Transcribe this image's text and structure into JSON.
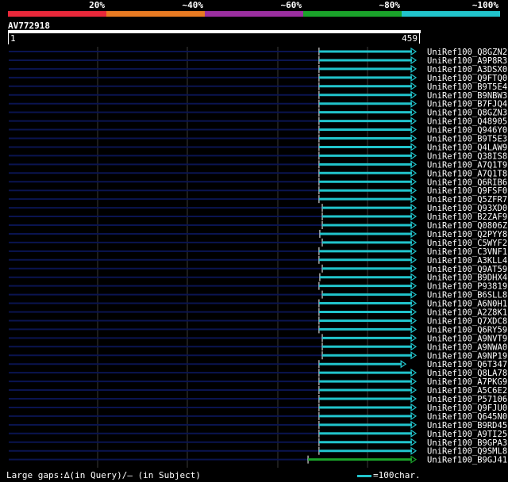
{
  "legend": {
    "segments": [
      {
        "label": "20%",
        "color": "#e8283a"
      },
      {
        "label": "~40%",
        "color": "#e87a22"
      },
      {
        "label": "~60%",
        "color": "#9b2fa0"
      },
      {
        "label": "~80%",
        "color": "#1aa32a"
      },
      {
        "label": "~100%",
        "color": "#21c4cc"
      }
    ]
  },
  "query": {
    "id": "AV772918",
    "start": "1",
    "end": "459"
  },
  "colors": {
    "unaligned": "#0a1450",
    "hit": "#21c4cc",
    "hit_alt": "#1aa32a",
    "grid": "#3a3a3a"
  },
  "hits": [
    {
      "label": "UniRef100_Q8GZN2",
      "start": 0.762,
      "end": 1.0,
      "color": "hit"
    },
    {
      "label": "UniRef100_A9P8R3",
      "start": 0.762,
      "end": 1.0,
      "color": "hit"
    },
    {
      "label": "UniRef100_A3DSX0",
      "start": 0.762,
      "end": 1.0,
      "color": "hit"
    },
    {
      "label": "UniRef100_Q9FTQ0",
      "start": 0.762,
      "end": 1.0,
      "color": "hit"
    },
    {
      "label": "UniRef100_B9T5E4",
      "start": 0.762,
      "end": 1.0,
      "color": "hit"
    },
    {
      "label": "UniRef100_B9NBW3",
      "start": 0.762,
      "end": 1.0,
      "color": "hit"
    },
    {
      "label": "UniRef100_B7FJQ4",
      "start": 0.762,
      "end": 1.0,
      "color": "hit"
    },
    {
      "label": "UniRef100_Q8GZN3",
      "start": 0.762,
      "end": 1.0,
      "color": "hit"
    },
    {
      "label": "UniRef100_Q48905",
      "start": 0.762,
      "end": 1.0,
      "color": "hit"
    },
    {
      "label": "UniRef100_Q946Y0",
      "start": 0.762,
      "end": 1.0,
      "color": "hit"
    },
    {
      "label": "UniRef100_B9T5E3",
      "start": 0.762,
      "end": 1.0,
      "color": "hit"
    },
    {
      "label": "UniRef100_Q4LAW9",
      "start": 0.762,
      "end": 1.0,
      "color": "hit"
    },
    {
      "label": "UniRef100_Q38IS8",
      "start": 0.762,
      "end": 1.0,
      "color": "hit"
    },
    {
      "label": "UniRef100_A7Q1T9",
      "start": 0.762,
      "end": 1.0,
      "color": "hit"
    },
    {
      "label": "UniRef100_A7Q1T8",
      "start": 0.762,
      "end": 1.0,
      "color": "hit"
    },
    {
      "label": "UniRef100_Q6RIB6",
      "start": 0.762,
      "end": 1.0,
      "color": "hit"
    },
    {
      "label": "UniRef100_Q9FSF0",
      "start": 0.762,
      "end": 1.0,
      "color": "hit"
    },
    {
      "label": "UniRef100_Q5ZFR7",
      "start": 0.762,
      "end": 1.0,
      "color": "hit"
    },
    {
      "label": "UniRef100_Q93XD0",
      "start": 0.77,
      "end": 1.0,
      "color": "hit"
    },
    {
      "label": "UniRef100_B2ZAF9",
      "start": 0.77,
      "end": 1.0,
      "color": "hit"
    },
    {
      "label": "UniRef100_Q0806Z",
      "start": 0.77,
      "end": 1.0,
      "color": "hit"
    },
    {
      "label": "UniRef100_Q2PYY8",
      "start": 0.764,
      "end": 1.0,
      "color": "hit"
    },
    {
      "label": "UniRef100_C5WYF2",
      "start": 0.77,
      "end": 1.0,
      "color": "hit"
    },
    {
      "label": "UniRef100_C3VNF1",
      "start": 0.762,
      "end": 1.0,
      "color": "hit"
    },
    {
      "label": "UniRef100_A3KLL4",
      "start": 0.762,
      "end": 1.0,
      "color": "hit"
    },
    {
      "label": "UniRef100_Q9AT59",
      "start": 0.77,
      "end": 1.0,
      "color": "hit"
    },
    {
      "label": "UniRef100_B9DHX4",
      "start": 0.764,
      "end": 1.0,
      "color": "hit"
    },
    {
      "label": "UniRef100_P93819",
      "start": 0.762,
      "end": 1.0,
      "color": "hit"
    },
    {
      "label": "UniRef100_B6SLL8",
      "start": 0.77,
      "end": 1.0,
      "color": "hit"
    },
    {
      "label": "UniRef100_A6N0H1",
      "start": 0.762,
      "end": 1.0,
      "color": "hit"
    },
    {
      "label": "UniRef100_A2Z8K1",
      "start": 0.762,
      "end": 1.0,
      "color": "hit"
    },
    {
      "label": "UniRef100_Q7XDC8",
      "start": 0.762,
      "end": 1.0,
      "color": "hit"
    },
    {
      "label": "UniRef100_Q6RY59",
      "start": 0.762,
      "end": 1.0,
      "color": "hit"
    },
    {
      "label": "UniRef100_A9NVT9",
      "start": 0.77,
      "end": 1.0,
      "color": "hit"
    },
    {
      "label": "UniRef100_A9NWA0",
      "start": 0.77,
      "end": 1.0,
      "color": "hit"
    },
    {
      "label": "UniRef100_A9NP19",
      "start": 0.77,
      "end": 1.0,
      "color": "hit"
    },
    {
      "label": "UniRef100_Q6T347",
      "start": 0.762,
      "end": 0.975,
      "color": "hit"
    },
    {
      "label": "UniRef100_Q8LA78",
      "start": 0.762,
      "end": 1.0,
      "color": "hit"
    },
    {
      "label": "UniRef100_A7PKG9",
      "start": 0.762,
      "end": 1.0,
      "color": "hit"
    },
    {
      "label": "UniRef100_A5C6E2",
      "start": 0.762,
      "end": 1.0,
      "color": "hit"
    },
    {
      "label": "UniRef100_P57106",
      "start": 0.762,
      "end": 1.0,
      "color": "hit"
    },
    {
      "label": "UniRef100_Q9FJU0",
      "start": 0.762,
      "end": 1.0,
      "color": "hit"
    },
    {
      "label": "UniRef100_Q645N0",
      "start": 0.762,
      "end": 1.0,
      "color": "hit"
    },
    {
      "label": "UniRef100_B9RD45",
      "start": 0.762,
      "end": 1.0,
      "color": "hit"
    },
    {
      "label": "UniRef100_A9TI25",
      "start": 0.762,
      "end": 1.0,
      "color": "hit"
    },
    {
      "label": "UniRef100_B9GPA3",
      "start": 0.762,
      "end": 1.0,
      "color": "hit"
    },
    {
      "label": "UniRef100_Q9SML8",
      "start": 0.762,
      "end": 1.0,
      "color": "hit"
    },
    {
      "label": "UniRef100_B9GJ41",
      "start": 0.735,
      "end": 1.0,
      "color": "hit_alt"
    }
  ],
  "footer": {
    "gaps_text": "Large gaps:∆(in Query)/– (in Subject)",
    "scale_text": "=100char."
  }
}
